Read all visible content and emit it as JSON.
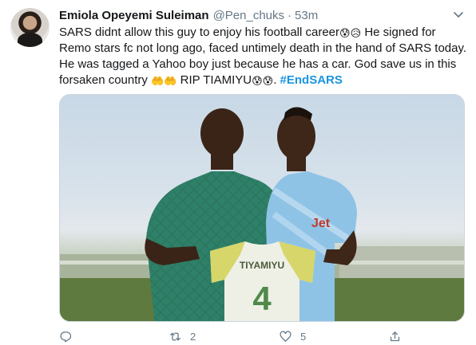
{
  "tweet": {
    "author": {
      "display_name": "Emiola Opeyemi Suleiman",
      "handle": "@Pen_chuks"
    },
    "separator": "·",
    "timestamp": "53m",
    "text_lines": [
      "SARS didnt allow this guy to enjoy his football career",
      "He signed for",
      "Remo stars fc not long ago, faced untimely death in the hand of SARS today.",
      "He was tagged a Yahoo boy just because he has a car. God save us in this",
      "forsaken country",
      "RIP TIAMIYU",
      "."
    ],
    "emoji": {
      "sad_pair_1": "😰😥",
      "hands_pair": "🤲🤲",
      "sad_pair_2": "😰😰"
    },
    "hashtag": "#EndSARS",
    "media": {
      "jersey_name": "TIYAMIYU",
      "jersey_number": "4",
      "sponsor_text": "Jet"
    },
    "actions": {
      "reply_count": "",
      "retweet_count": "2",
      "like_count": "5"
    }
  },
  "colors": {
    "text": "#14171a",
    "secondary": "#657786",
    "link": "#1b95e0",
    "border": "#ccd6dd"
  },
  "icons": [
    "chevron-down-icon",
    "reply-icon",
    "retweet-icon",
    "heart-icon",
    "share-icon"
  ]
}
